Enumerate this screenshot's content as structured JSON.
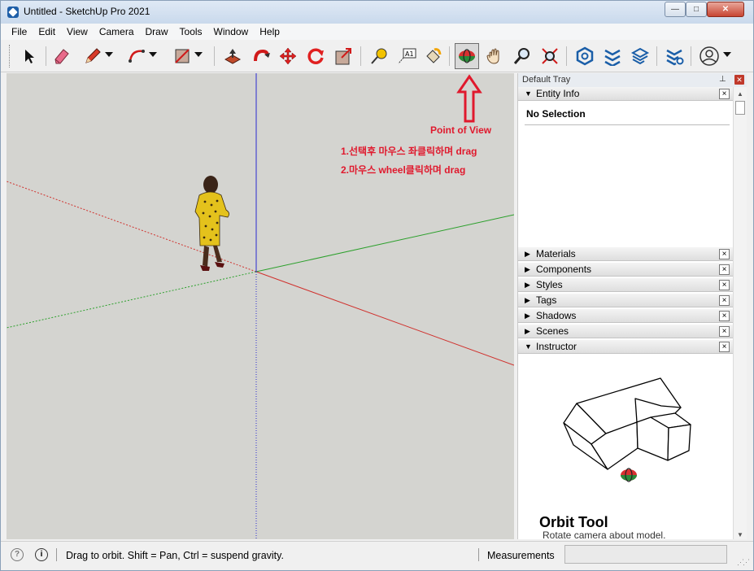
{
  "window": {
    "title": "Untitled - SketchUp Pro 2021",
    "min_glyph": "—",
    "max_glyph": "□",
    "close_glyph": "✕"
  },
  "menu": [
    "File",
    "Edit",
    "View",
    "Camera",
    "Draw",
    "Tools",
    "Window",
    "Help"
  ],
  "toolbar": {
    "tools": [
      {
        "name": "select-tool-icon",
        "glyph": "➤"
      },
      {
        "name": "eraser-tool-icon",
        "glyph": "◆"
      },
      {
        "name": "pencil-line-tool-icon",
        "glyph": "✎"
      },
      {
        "name": "arc-tool-icon",
        "glyph": "◠"
      },
      {
        "name": "rectangle-tool-icon",
        "glyph": "▨"
      },
      {
        "name": "push-pull-tool-icon",
        "glyph": "⬒"
      },
      {
        "name": "offset-tool-icon",
        "glyph": "↻"
      },
      {
        "name": "move-tool-icon",
        "glyph": "✥"
      },
      {
        "name": "rotate-tool-icon",
        "glyph": "⟳"
      },
      {
        "name": "scale-tool-icon",
        "glyph": "⤢"
      },
      {
        "name": "tape-measure-tool-icon",
        "glyph": "✐"
      },
      {
        "name": "text-tool-icon",
        "glyph": "A1"
      },
      {
        "name": "paint-bucket-tool-icon",
        "glyph": "⚗"
      },
      {
        "name": "orbit-tool-icon",
        "glyph": "◉"
      },
      {
        "name": "pan-tool-icon",
        "glyph": "✋"
      },
      {
        "name": "zoom-tool-icon",
        "glyph": "⚲"
      },
      {
        "name": "zoom-extents-tool-icon",
        "glyph": "✕"
      },
      {
        "name": "3d-warehouse-icon",
        "glyph": "⬢"
      },
      {
        "name": "extension-warehouse-icon",
        "glyph": "≋"
      },
      {
        "name": "layout-send-icon",
        "glyph": "⧉"
      },
      {
        "name": "extension-manager-icon",
        "glyph": "⚙"
      },
      {
        "name": "account-icon",
        "glyph": "◯"
      }
    ]
  },
  "annotation": {
    "title": "Point of View",
    "line1": "1.선택후 마우스 좌클릭하며 drag",
    "line2": "2.마우스 wheel클릭하며 drag",
    "color": "#e0192d"
  },
  "tray": {
    "title": "Default Tray",
    "pin_glyph": "⊥",
    "close_glyph": "✕",
    "entity_info": {
      "label": "Entity Info",
      "value": "No Selection"
    },
    "panels": [
      "Materials",
      "Components",
      "Styles",
      "Tags",
      "Shadows",
      "Scenes"
    ],
    "instructor": {
      "label": "Instructor",
      "tool_title": "Orbit Tool",
      "tool_desc": "Rotate camera about model."
    }
  },
  "statusbar": {
    "hint": "Drag to orbit. Shift = Pan, Ctrl = suspend gravity.",
    "measurements_label": "Measurements",
    "measurements_value": "",
    "info_glyph": "i",
    "geo_glyph": "?"
  },
  "axes_colors": {
    "red": "#d0312d",
    "green": "#2ca02c",
    "blue": "#2a2ad0"
  }
}
